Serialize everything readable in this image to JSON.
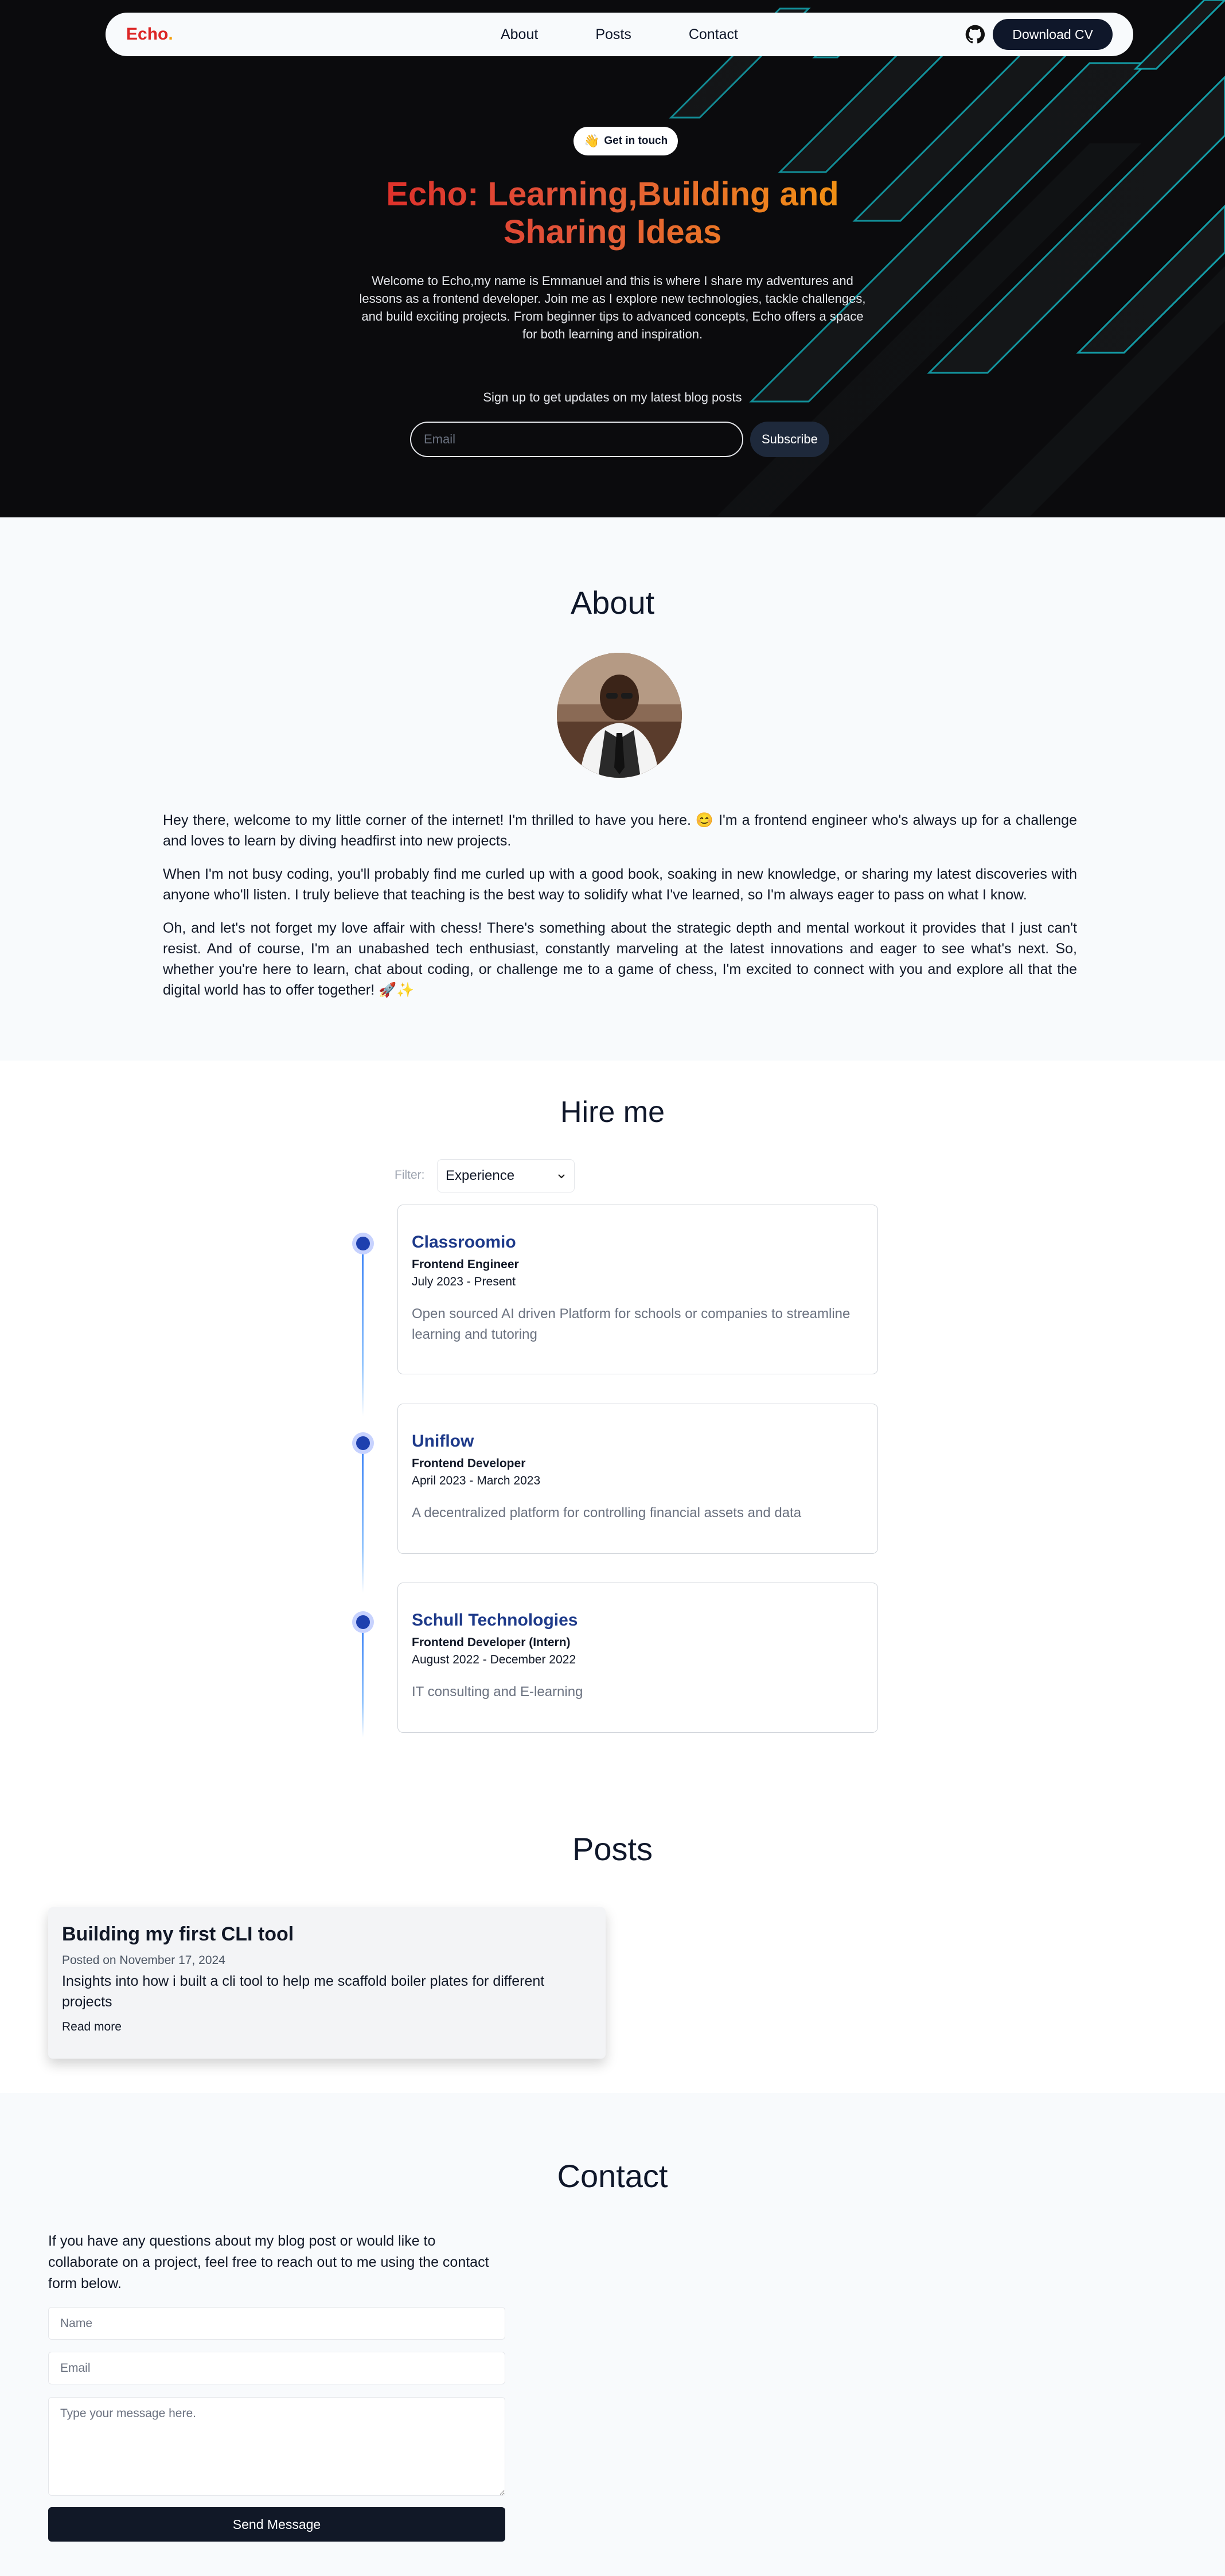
{
  "nav": {
    "logo_text": "Echo",
    "logo_dot": ".",
    "links": [
      "About",
      "Posts",
      "Contact"
    ],
    "cv_button": "Download CV"
  },
  "hero": {
    "pill_emoji": "👋",
    "pill_label": "Get in touch",
    "title": "Echo: Learning,Building and Sharing Ideas",
    "description": "Welcome to Echo,my name is Emmanuel and this is where I share my adventures and lessons as a frontend developer. Join me as I explore new technologies, tackle challenges, and build exciting projects. From beginner tips to advanced concepts, Echo offers a space for both learning and inspiration.",
    "signup_label": "Sign up to get updates on my latest blog posts",
    "email_placeholder": "Email",
    "subscribe_button": "Subscribe"
  },
  "about": {
    "title": "About",
    "paragraphs": [
      "Hey there, welcome to my little corner of the internet! I'm thrilled to have you here. 😊 I'm a frontend engineer who's always up for a challenge and loves to learn by diving headfirst into new projects.",
      "When I'm not busy coding, you'll probably find me curled up with a good book, soaking in new knowledge, or sharing my latest discoveries with anyone who'll listen. I truly believe that teaching is the best way to solidify what I've learned, so I'm always eager to pass on what I know.",
      "Oh, and let's not forget my love affair with chess! There's something about the strategic depth and mental workout it provides that I just can't resist. And of course, I'm an unabashed tech enthusiast, constantly marveling at the latest innovations and eager to see what's next. So, whether you're here to learn, chat about coding, or challenge me to a game of chess, I'm excited to connect with you and explore all that the digital world has to offer together! 🚀✨"
    ]
  },
  "hire": {
    "title": "Hire me",
    "filter_label": "Filter:",
    "filter_value": "Experience",
    "experiences": [
      {
        "company": "Classroomio",
        "role": "Frontend Engineer",
        "period": "July 2023 - Present",
        "description": "Open sourced AI driven Platform for schools or companies to streamline learning and tutoring"
      },
      {
        "company": "Uniflow",
        "role": "Frontend Developer",
        "period": "April 2023 - March 2023",
        "description": "A decentralized platform for controlling financial assets and data"
      },
      {
        "company": "Schull Technologies",
        "role": "Frontend Developer (Intern)",
        "period": "August 2022 - December 2022",
        "description": "IT consulting and E-learning"
      }
    ]
  },
  "posts": {
    "title": "Posts",
    "items": [
      {
        "title": "Building my first CLI tool",
        "date": "Posted on November 17, 2024",
        "excerpt": "Insights into how i built a cli tool to help me scaffold boiler plates for different projects",
        "link": "Read more"
      }
    ]
  },
  "contact": {
    "title": "Contact",
    "intro": "If you have any questions about my blog post or would like to collaborate on a project, feel free to reach out to me using the contact form below.",
    "name_placeholder": "Name",
    "email_placeholder": "Email",
    "message_placeholder": "Type your message here.",
    "send_button": "Send Message"
  },
  "colors": {
    "hero_bg": "#0b0b0d",
    "accent_red": "#dc2626",
    "accent_orange": "#f59e0b",
    "neon_cyan": "#22d3ee",
    "navy": "#0f172a",
    "timeline_blue": "#1e40af"
  },
  "icons": [
    "github-icon",
    "waving-hand-icon",
    "chevron-down-icon"
  ]
}
